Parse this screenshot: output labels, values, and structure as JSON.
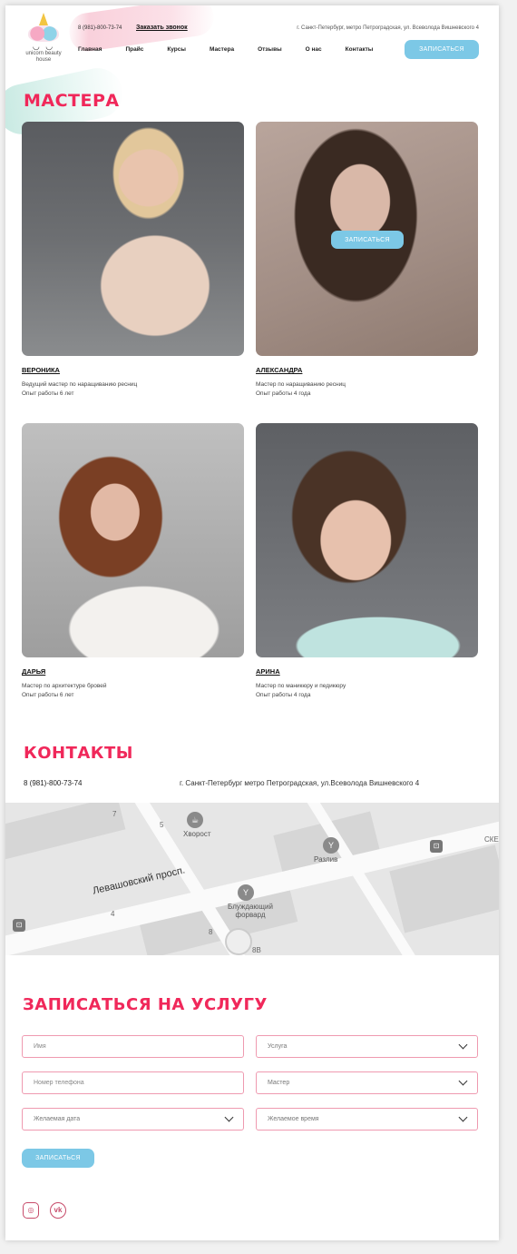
{
  "header": {
    "logo_text": "unicorn beauty house",
    "phone": "8 (981)-800-73-74",
    "call_link": "Заказать звонок",
    "address": "г. Санкт-Петербург, метро Петроградская, ул. Всеволода Вишневского 4",
    "nav": [
      "Главная",
      "Прайс",
      "Курсы",
      "Мастера",
      "Отзывы",
      "О нас",
      "Контакты"
    ],
    "cta": "ЗАПИСАТЬСЯ"
  },
  "masters": {
    "title": "МАСТЕРА",
    "photo_button": "ЗАПИСАТЬСЯ",
    "items": [
      {
        "name": "ВЕРОНИКА",
        "role": "Ведущий мастер по наращиванию ресниц",
        "exp": "Опыт работы 6 лет"
      },
      {
        "name": "АЛЕКСАНДРА",
        "role": "Мастер по наращиванию ресниц",
        "exp": "Опыт работы 4 года"
      },
      {
        "name": "ДАРЬЯ",
        "role": "Мастер по архитектуре бровей",
        "exp": "Опыт работы 6 лет"
      },
      {
        "name": "АРИНА",
        "role": "Мастер по маникюру и педикюру",
        "exp": "Опыт работы 4 года"
      }
    ]
  },
  "contacts": {
    "title": "КОНТАКТЫ",
    "phone": "8 (981)-800-73-74",
    "address": "г. Санкт-Петербург метро Петроградская, ул.Всеволода Вишневского 4",
    "map": {
      "street": "Левашовский просп.",
      "poi": [
        "Хворост",
        "Разлив",
        "Блуждающий форвард"
      ],
      "numbers": [
        "5",
        "7",
        "4",
        "8",
        "8В"
      ],
      "edge_label": "СКЕ"
    }
  },
  "booking": {
    "title": "ЗАПИСАТЬСЯ НА УСЛУГУ",
    "fields": {
      "name": "Имя",
      "service": "Услуга",
      "phone": "Номер телефона",
      "master": "Мастер",
      "date": "Желаемая дата",
      "time": "Желаемое время"
    },
    "submit": "ЗАПИСАТЬСЯ"
  },
  "social": {
    "instagram": "instagram-icon",
    "vk": "vk-icon",
    "vk_label": "vk"
  },
  "colors": {
    "accent": "#f0285a",
    "button": "#7cc8e6",
    "field_border": "#ef9ab0"
  }
}
